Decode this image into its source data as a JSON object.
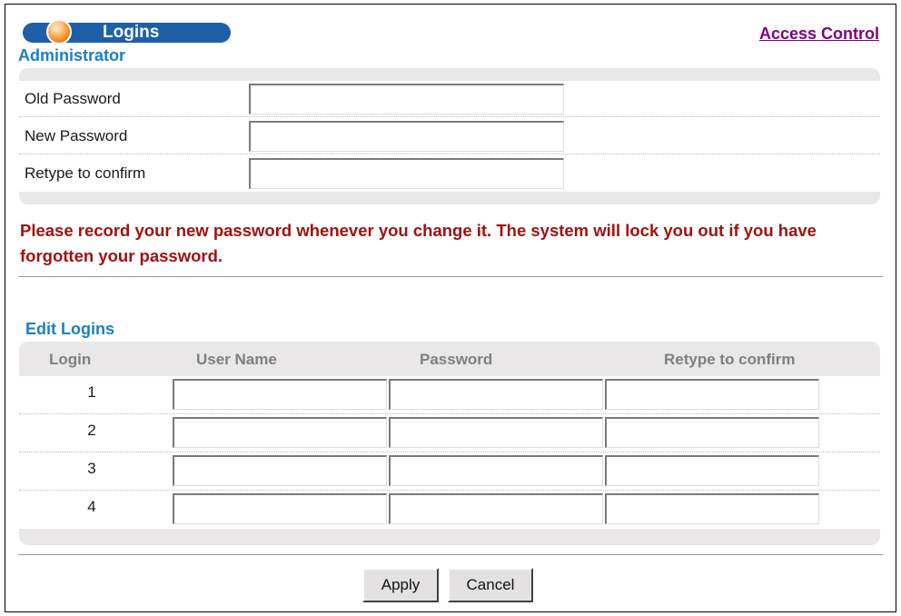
{
  "header": {
    "title": "Logins",
    "access_control_link": "Access Control"
  },
  "administrator": {
    "section_title": "Administrator",
    "fields": [
      {
        "label": "Old Password",
        "value": ""
      },
      {
        "label": "New Password",
        "value": ""
      },
      {
        "label": "Retype to confirm",
        "value": ""
      }
    ]
  },
  "warning": "Please record your new password whenever you change it. The system will lock you out if you have forgotten your password.",
  "edit_logins": {
    "section_title": "Edit Logins",
    "columns": [
      "Login",
      "User Name",
      "Password",
      "Retype to confirm"
    ],
    "rows": [
      {
        "login": "1",
        "user_name": "",
        "password": "",
        "retype": ""
      },
      {
        "login": "2",
        "user_name": "",
        "password": "",
        "retype": ""
      },
      {
        "login": "3",
        "user_name": "",
        "password": "",
        "retype": ""
      },
      {
        "login": "4",
        "user_name": "",
        "password": "",
        "retype": ""
      }
    ]
  },
  "buttons": {
    "apply": "Apply",
    "cancel": "Cancel"
  },
  "icons": {
    "header_ball": "orange-ball-icon"
  },
  "colors": {
    "header_pill": "#1f5fa8",
    "section_title": "#1c7fc4",
    "warning": "#a11111",
    "link_visited": "#800080",
    "column_header": "#7f7f7f",
    "panel_bg": "#e9e7e7"
  }
}
